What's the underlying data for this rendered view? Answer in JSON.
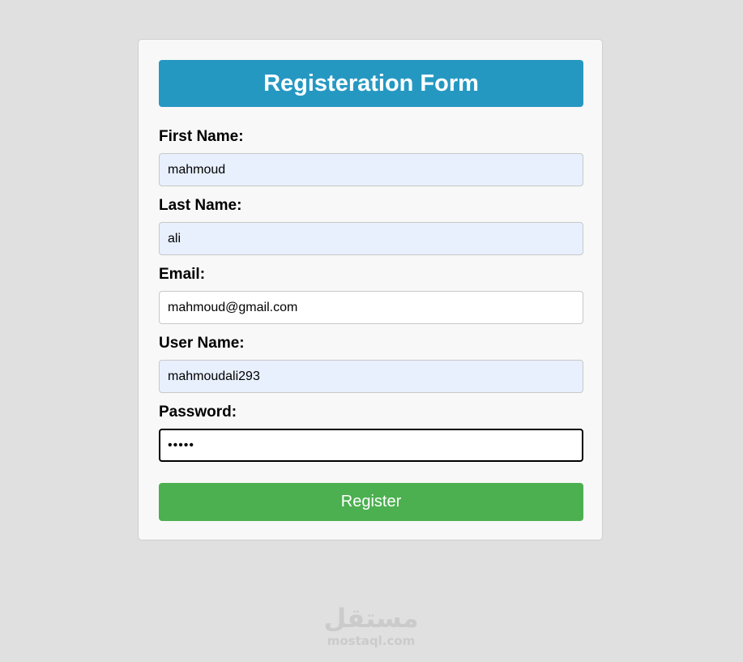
{
  "form": {
    "title": "Registeration Form",
    "fields": [
      {
        "label": "First Name:",
        "value": "mahmoud",
        "type": "text"
      },
      {
        "label": "Last Name:",
        "value": "ali",
        "type": "text"
      },
      {
        "label": "Email:",
        "value": "mahmoud@gmail.com",
        "type": "email"
      },
      {
        "label": "User Name:",
        "value": "mahmoudali293",
        "type": "text"
      },
      {
        "label": "Password:",
        "value": "•••••",
        "type": "password"
      }
    ],
    "submit_label": "Register"
  },
  "colors": {
    "page_background": "#e0e0e0",
    "header_background": "#2598c2",
    "autofill_background": "#e8f0fe",
    "button_background": "#4caf50"
  },
  "watermark": {
    "logo_text": "مستقل",
    "domain": "mostaql.com"
  }
}
